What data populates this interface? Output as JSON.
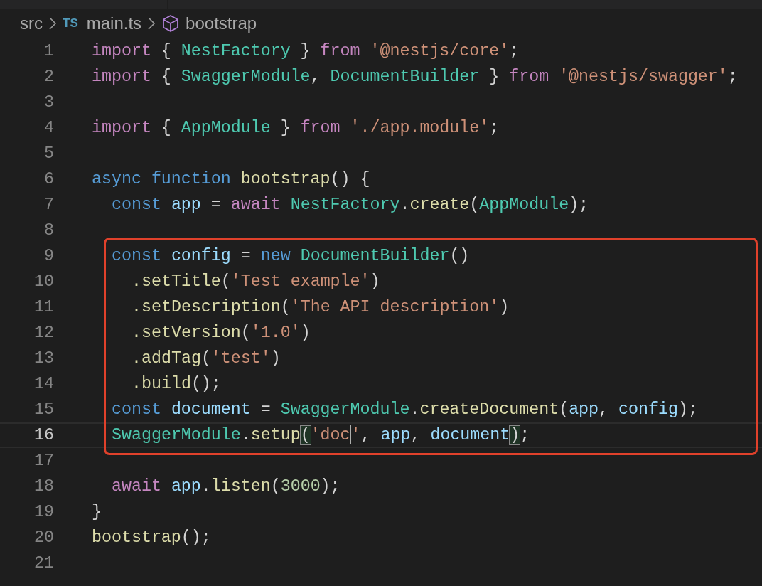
{
  "breadcrumbs": [
    {
      "kind": "folder",
      "label": "src"
    },
    {
      "kind": "file",
      "badge": "TS",
      "label": "main.ts"
    },
    {
      "kind": "symbol",
      "label": "bootstrap"
    }
  ],
  "code": [
    {
      "kind": "line",
      "number": "1",
      "tokens": [
        {
          "kind": "control",
          "s": "import"
        },
        {
          "kind": "punct",
          "s": " { "
        },
        {
          "kind": "type",
          "s": "NestFactory"
        },
        {
          "kind": "punct",
          "s": " } "
        },
        {
          "kind": "control",
          "s": "from"
        },
        {
          "kind": "string",
          "s": " '@nestjs/core'"
        },
        {
          "kind": "punct",
          "s": ";"
        }
      ]
    },
    {
      "kind": "line",
      "number": "2",
      "tokens": [
        {
          "kind": "control",
          "s": "import"
        },
        {
          "kind": "punct",
          "s": " { "
        },
        {
          "kind": "type",
          "s": "SwaggerModule"
        },
        {
          "kind": "punct",
          "s": ", "
        },
        {
          "kind": "type",
          "s": "DocumentBuilder"
        },
        {
          "kind": "punct",
          "s": " } "
        },
        {
          "kind": "control",
          "s": "from"
        },
        {
          "kind": "string",
          "s": " '@nestjs/swagger'"
        },
        {
          "kind": "punct",
          "s": ";"
        }
      ]
    },
    {
      "kind": "line",
      "number": "3"
    },
    {
      "kind": "line",
      "number": "4",
      "tokens": [
        {
          "kind": "control",
          "s": "import"
        },
        {
          "kind": "punct",
          "s": " { "
        },
        {
          "kind": "type",
          "s": "AppModule"
        },
        {
          "kind": "punct",
          "s": " } "
        },
        {
          "kind": "control",
          "s": "from"
        },
        {
          "kind": "string",
          "s": " './app.module'"
        },
        {
          "kind": "punct",
          "s": ";"
        }
      ]
    },
    {
      "kind": "line",
      "number": "5"
    },
    {
      "kind": "line",
      "number": "6",
      "tokens": [
        {
          "kind": "keyword",
          "s": "async"
        },
        {
          "kind": "keyword",
          "s": " function"
        },
        {
          "kind": "func",
          "s": " bootstrap"
        },
        {
          "kind": "punct",
          "s": "() {"
        }
      ]
    },
    {
      "kind": "block",
      "children": [
        {
          "kind": "line",
          "number": "7",
          "tokens": [
            {
              "kind": "keyword",
              "s": "const"
            },
            {
              "kind": "var",
              "s": " app"
            },
            {
              "kind": "punct",
              "s": " = "
            },
            {
              "kind": "control",
              "s": "await"
            },
            {
              "kind": "type",
              "s": " NestFactory"
            },
            {
              "kind": "punct",
              "s": "."
            },
            {
              "kind": "func",
              "s": "create"
            },
            {
              "kind": "punct",
              "s": "("
            },
            {
              "kind": "type",
              "s": "AppModule"
            },
            {
              "kind": "punct",
              "s": ");"
            }
          ]
        },
        {
          "kind": "line",
          "number": "8"
        },
        {
          "kind": "annotation_box",
          "color": "#e0412b",
          "children": [
            {
              "kind": "line",
              "number": "9",
              "tokens": [
                {
                  "kind": "keyword",
                  "s": "const"
                },
                {
                  "kind": "var",
                  "s": " config"
                },
                {
                  "kind": "punct",
                  "s": " = "
                },
                {
                  "kind": "keyword",
                  "s": "new"
                },
                {
                  "kind": "type",
                  "s": " DocumentBuilder"
                },
                {
                  "kind": "punct",
                  "s": "()"
                }
              ]
            },
            {
              "kind": "block",
              "children": [
                {
                  "kind": "line",
                  "number": "10",
                  "tokens": [
                    {
                      "kind": "func",
                      "s": ".setTitle"
                    },
                    {
                      "kind": "punct",
                      "s": "("
                    },
                    {
                      "kind": "string",
                      "s": "'Test example'"
                    },
                    {
                      "kind": "punct",
                      "s": ")"
                    }
                  ]
                },
                {
                  "kind": "line",
                  "number": "11",
                  "tokens": [
                    {
                      "kind": "func",
                      "s": ".setDescription"
                    },
                    {
                      "kind": "punct",
                      "s": "("
                    },
                    {
                      "kind": "string",
                      "s": "'The API description'"
                    },
                    {
                      "kind": "punct",
                      "s": ")"
                    }
                  ]
                },
                {
                  "kind": "line",
                  "number": "12",
                  "tokens": [
                    {
                      "kind": "func",
                      "s": ".setVersion"
                    },
                    {
                      "kind": "punct",
                      "s": "("
                    },
                    {
                      "kind": "string",
                      "s": "'1.0'"
                    },
                    {
                      "kind": "punct",
                      "s": ")"
                    }
                  ]
                },
                {
                  "kind": "line",
                  "number": "13",
                  "tokens": [
                    {
                      "kind": "func",
                      "s": ".addTag"
                    },
                    {
                      "kind": "punct",
                      "s": "("
                    },
                    {
                      "kind": "string",
                      "s": "'test'"
                    },
                    {
                      "kind": "punct",
                      "s": ")"
                    }
                  ]
                },
                {
                  "kind": "line",
                  "number": "14",
                  "tokens": [
                    {
                      "kind": "func",
                      "s": ".build"
                    },
                    {
                      "kind": "punct",
                      "s": "();"
                    }
                  ]
                }
              ]
            },
            {
              "kind": "line",
              "number": "15",
              "tokens": [
                {
                  "kind": "keyword",
                  "s": "const"
                },
                {
                  "kind": "var",
                  "s": " document"
                },
                {
                  "kind": "punct",
                  "s": " = "
                },
                {
                  "kind": "type",
                  "s": "SwaggerModule"
                },
                {
                  "kind": "punct",
                  "s": "."
                },
                {
                  "kind": "func",
                  "s": "createDocument"
                },
                {
                  "kind": "punct",
                  "s": "("
                },
                {
                  "kind": "var",
                  "s": "app"
                },
                {
                  "kind": "punct",
                  "s": ", "
                },
                {
                  "kind": "var",
                  "s": "config"
                },
                {
                  "kind": "punct",
                  "s": ");"
                }
              ]
            },
            {
              "kind": "line",
              "number": "16",
              "current": true,
              "tokens": [
                {
                  "kind": "type",
                  "s": "SwaggerModule"
                },
                {
                  "kind": "punct",
                  "s": "."
                },
                {
                  "kind": "func",
                  "s": "setup"
                },
                {
                  "kind": "punct",
                  "s": "(",
                  "bracket_match": true
                },
                {
                  "kind": "string",
                  "s": "'doc",
                  "cursor_after": true
                },
                {
                  "kind": "string",
                  "s": "'"
                },
                {
                  "kind": "punct",
                  "s": ", "
                },
                {
                  "kind": "var",
                  "s": "app"
                },
                {
                  "kind": "punct",
                  "s": ", "
                },
                {
                  "kind": "var",
                  "s": "document"
                },
                {
                  "kind": "punct",
                  "s": ")",
                  "bracket_match": true
                },
                {
                  "kind": "punct",
                  "s": ";"
                }
              ]
            }
          ]
        },
        {
          "kind": "line",
          "number": "17"
        },
        {
          "kind": "line",
          "number": "18",
          "tokens": [
            {
              "kind": "control",
              "s": "await"
            },
            {
              "kind": "var",
              "s": " app"
            },
            {
              "kind": "punct",
              "s": "."
            },
            {
              "kind": "func",
              "s": "listen"
            },
            {
              "kind": "punct",
              "s": "("
            },
            {
              "kind": "number",
              "s": "3000"
            },
            {
              "kind": "punct",
              "s": ");"
            }
          ]
        }
      ]
    },
    {
      "kind": "line",
      "number": "19",
      "tokens": [
        {
          "kind": "punct",
          "s": "}"
        }
      ]
    },
    {
      "kind": "line",
      "number": "20",
      "tokens": [
        {
          "kind": "func",
          "s": "bootstrap"
        },
        {
          "kind": "punct",
          "s": "();"
        }
      ]
    },
    {
      "kind": "line",
      "number": "21"
    }
  ]
}
